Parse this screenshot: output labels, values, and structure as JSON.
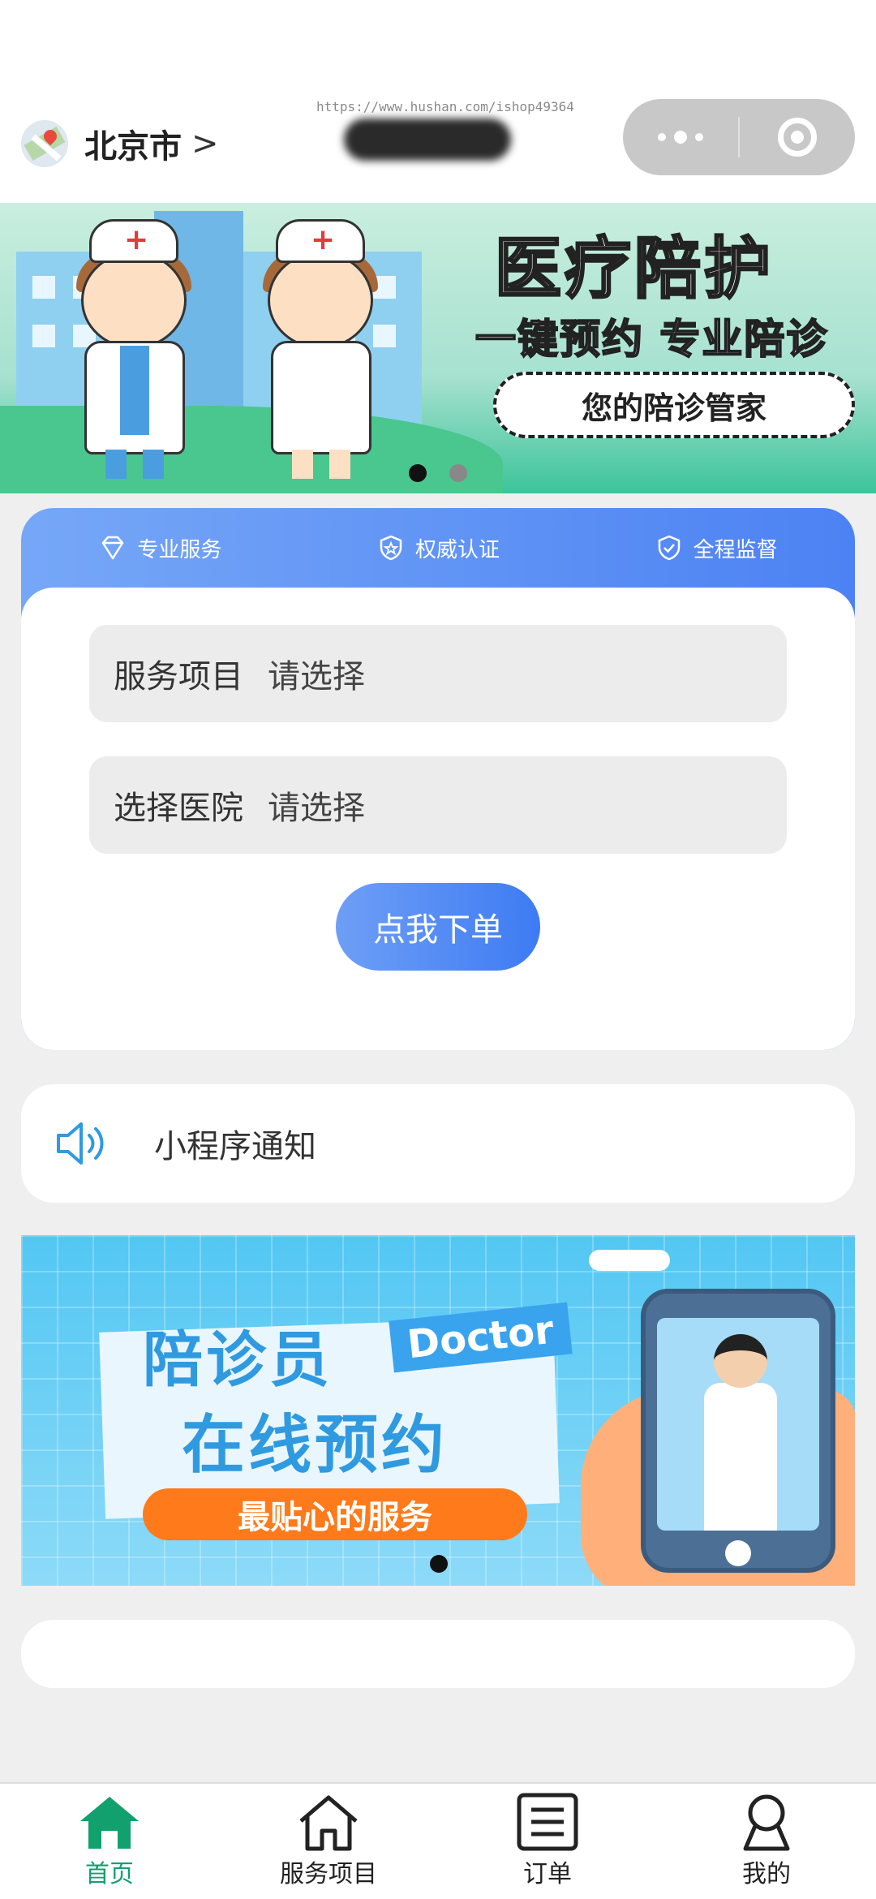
{
  "header": {
    "city": "北京市",
    "arrow": ">",
    "watermark": "https://www.hushan.com/ishop49364"
  },
  "banner_top": {
    "title": "医疗陪护",
    "subtitle": "一键预约 专业陪诊",
    "slogan": "您的陪诊管家",
    "slide_count": 2,
    "active_slide": 1
  },
  "order_card": {
    "badges": [
      {
        "label": "专业服务",
        "icon": "diamond-icon"
      },
      {
        "label": "权威认证",
        "icon": "shield-star-icon"
      },
      {
        "label": "全程监督",
        "icon": "shield-check-icon"
      }
    ],
    "service_field": {
      "label": "服务项目",
      "placeholder": "请选择"
    },
    "hospital_field": {
      "label": "选择医院",
      "placeholder": "请选择"
    },
    "submit_label": "点我下单"
  },
  "notice": {
    "icon": "speaker-icon",
    "text": "小程序通知"
  },
  "banner_bottom": {
    "title_line1": "陪诊员",
    "tag": "Doctor",
    "title_line2": "在线预约",
    "slogan": "最贴心的服务"
  },
  "tabbar": {
    "items": [
      {
        "label": "首页",
        "icon": "home-filled-icon",
        "active": true
      },
      {
        "label": "服务项目",
        "icon": "home-outline-icon",
        "active": false
      },
      {
        "label": "订单",
        "icon": "list-icon",
        "active": false
      },
      {
        "label": "我的",
        "icon": "user-icon",
        "active": false
      }
    ]
  },
  "colors": {
    "accent_blue": "#4c82f3",
    "active_tab": "#11a06e",
    "notice_icon": "#2f9ae0"
  }
}
